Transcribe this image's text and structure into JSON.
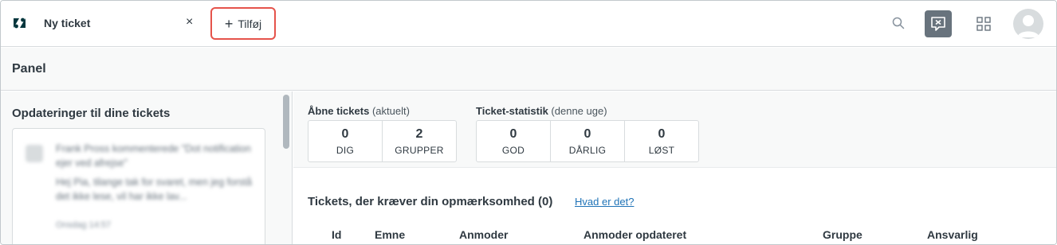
{
  "header": {
    "tab_label": "Ny ticket",
    "tab_close": "×",
    "add_tab_plus": "+",
    "add_tab_label": "Tilføj",
    "chat_glyph": "✕"
  },
  "panel": {
    "title": "Panel"
  },
  "updates": {
    "title": "Opdateringer til dine tickets",
    "item": {
      "line1": "Frank Pross kommenterede \"Dot notification ejer ved afrejse\"",
      "line2": "Hej Pia, tilange tak for svaret, men jeg forstå det ikke lese, vil har ikke lav...",
      "time": "Onsdag 14:57"
    }
  },
  "open_tickets": {
    "label": "Åbne tickets",
    "sublabel": "(aktuelt)",
    "boxes": [
      {
        "value": "0",
        "label": "DIG"
      },
      {
        "value": "2",
        "label": "GRUPPER"
      }
    ]
  },
  "ticket_stats": {
    "label": "Ticket-statistik",
    "sublabel": "(denne uge)",
    "boxes": [
      {
        "value": "0",
        "label": "GOD"
      },
      {
        "value": "0",
        "label": "DÅRLIG"
      },
      {
        "value": "0",
        "label": "LØST"
      }
    ]
  },
  "attention": {
    "title": "Tickets, der kræver din opmærksomhed (0)",
    "link": "Hvad er det?",
    "columns": [
      "Id",
      "Emne",
      "Anmoder",
      "Anmoder opdateret",
      "Gruppe",
      "Ansvarlig"
    ]
  },
  "colors": {
    "accent_link": "#1f73b7",
    "add_tab_border": "#e5534b",
    "chat_icon_bg": "#68737d",
    "panel_bg": "#f8f9f9"
  }
}
